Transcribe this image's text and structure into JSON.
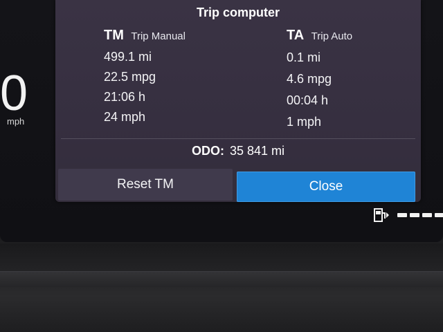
{
  "cluster": {
    "speed_value": "0",
    "speed_unit": "mph"
  },
  "trip_computer": {
    "title": "Trip computer",
    "manual": {
      "code": "TM",
      "name": "Trip Manual",
      "distance": "499.1 mi",
      "economy": "22.5 mpg",
      "time": "21:06 h",
      "avg_speed": "24 mph"
    },
    "auto": {
      "code": "TA",
      "name": "Trip Auto",
      "distance": "0.1 mi",
      "economy": "4.6 mpg",
      "time": "00:04 h",
      "avg_speed": "1 mph"
    },
    "odo": {
      "label": "ODO:",
      "value": "35 841 mi"
    },
    "buttons": {
      "reset_label": "Reset TM",
      "close_label": "Close"
    }
  },
  "fuel_gauge": {
    "icon": "fuel-pump-icon",
    "segments_visible": 4
  },
  "colors": {
    "popup_bg": "#3a3344",
    "close_button": "#1f84d6",
    "reset_button": "#403a4c"
  }
}
